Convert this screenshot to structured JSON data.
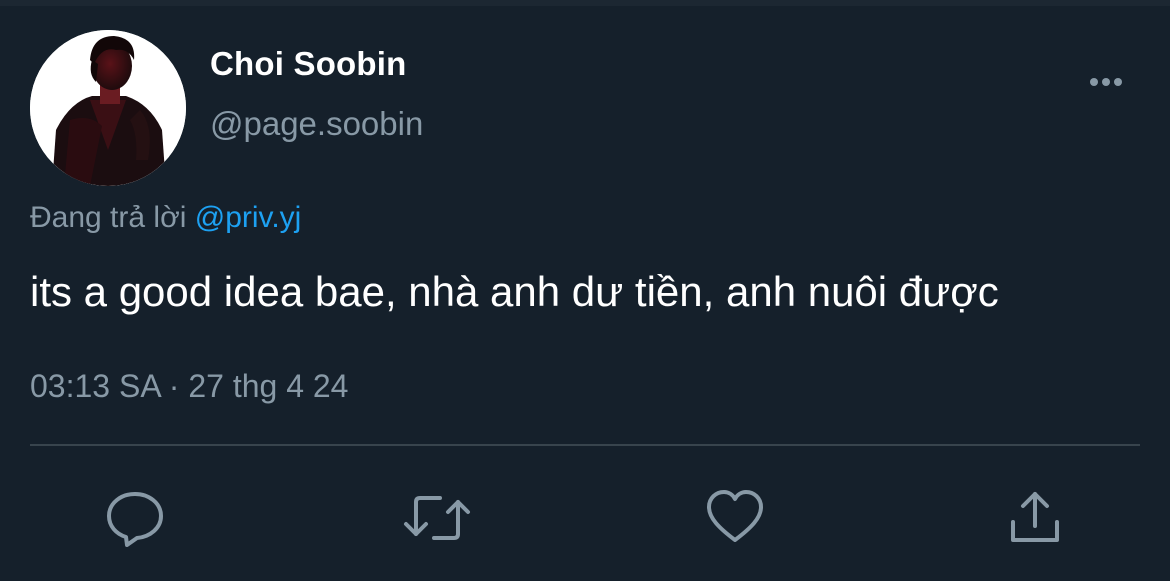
{
  "tweet": {
    "display_name": "Choi Soobin",
    "handle": "@page.soobin",
    "reply_prefix": "Đang trả lời",
    "reply_mention": "@priv.yj",
    "text": "its a good idea bae, nhà anh dư tiền, anh nuôi được",
    "timestamp": "03:13 SA · 27 thg 4 24"
  },
  "icons": {
    "more": "more-horizontal-icon",
    "reply": "comment-bubble-icon",
    "retweet": "retweet-arrows-icon",
    "like": "heart-icon",
    "share": "share-upload-icon"
  },
  "colors": {
    "background": "#15202b",
    "primary_text": "#ffffff",
    "secondary_text": "#8899a6",
    "accent": "#1da1f2",
    "divider": "#38444d"
  }
}
